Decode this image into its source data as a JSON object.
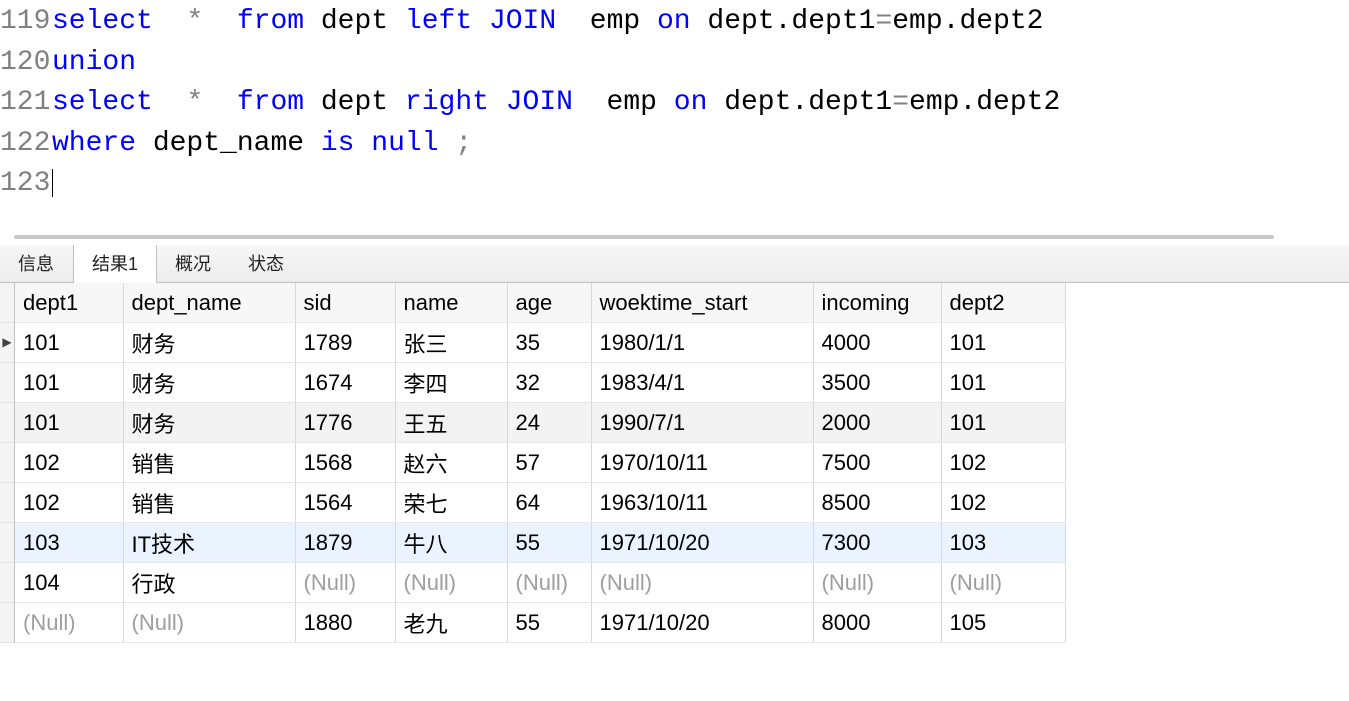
{
  "editor": {
    "lines": [
      {
        "num": 119,
        "tokens": [
          {
            "t": "select",
            "c": "kw"
          },
          {
            "t": "  "
          },
          {
            "t": "*",
            "c": "star"
          },
          {
            "t": "  "
          },
          {
            "t": "from",
            "c": "kw"
          },
          {
            "t": " dept "
          },
          {
            "t": "left",
            "c": "kw"
          },
          {
            "t": " "
          },
          {
            "t": "JOIN",
            "c": "kw"
          },
          {
            "t": "  emp "
          },
          {
            "t": "on",
            "c": "kw"
          },
          {
            "t": " dept.dept1"
          },
          {
            "t": "=",
            "c": "op"
          },
          {
            "t": "emp.dept2"
          }
        ]
      },
      {
        "num": 120,
        "tokens": [
          {
            "t": "union",
            "c": "kw"
          }
        ]
      },
      {
        "num": 121,
        "tokens": [
          {
            "t": "select",
            "c": "kw"
          },
          {
            "t": "  "
          },
          {
            "t": "*",
            "c": "star"
          },
          {
            "t": "  "
          },
          {
            "t": "from",
            "c": "kw"
          },
          {
            "t": " dept "
          },
          {
            "t": "right",
            "c": "kw"
          },
          {
            "t": " "
          },
          {
            "t": "JOIN",
            "c": "kw"
          },
          {
            "t": "  emp "
          },
          {
            "t": "on",
            "c": "kw"
          },
          {
            "t": " dept.dept1"
          },
          {
            "t": "=",
            "c": "op"
          },
          {
            "t": "emp.dept2"
          }
        ]
      },
      {
        "num": 122,
        "tokens": [
          {
            "t": "where",
            "c": "kw"
          },
          {
            "t": " dept_name "
          },
          {
            "t": "is",
            "c": "kw"
          },
          {
            "t": " "
          },
          {
            "t": "null",
            "c": "kw"
          },
          {
            "t": " "
          },
          {
            "t": ";",
            "c": "op"
          }
        ]
      },
      {
        "num": 123,
        "tokens": [],
        "cursor": true
      }
    ]
  },
  "tabs": [
    {
      "label": "信息",
      "active": false
    },
    {
      "label": "结果1",
      "active": true
    },
    {
      "label": "概况",
      "active": false
    },
    {
      "label": "状态",
      "active": false
    }
  ],
  "grid": {
    "null_label": "(Null)",
    "selected_row": 0,
    "columns": [
      {
        "key": "dept1",
        "label": "dept1",
        "numeric": false
      },
      {
        "key": "dept_name",
        "label": "dept_name",
        "numeric": false
      },
      {
        "key": "sid",
        "label": "sid",
        "numeric": false
      },
      {
        "key": "name",
        "label": "name",
        "numeric": false
      },
      {
        "key": "age",
        "label": "age",
        "numeric": true
      },
      {
        "key": "woektime_start",
        "label": "woektime_start",
        "numeric": false
      },
      {
        "key": "incoming",
        "label": "incoming",
        "numeric": true
      },
      {
        "key": "dept2",
        "label": "dept2",
        "numeric": false
      }
    ],
    "rows": [
      {
        "dept1": "101",
        "dept_name": "财务",
        "sid": "1789",
        "name": "张三",
        "age": 35,
        "woektime_start": "1980/1/1",
        "incoming": 4000,
        "dept2": "101"
      },
      {
        "dept1": "101",
        "dept_name": "财务",
        "sid": "1674",
        "name": "李四",
        "age": 32,
        "woektime_start": "1983/4/1",
        "incoming": 3500,
        "dept2": "101"
      },
      {
        "dept1": "101",
        "dept_name": "财务",
        "sid": "1776",
        "name": "王五",
        "age": 24,
        "woektime_start": "1990/7/1",
        "incoming": 2000,
        "dept2": "101"
      },
      {
        "dept1": "102",
        "dept_name": "销售",
        "sid": "1568",
        "name": "赵六",
        "age": 57,
        "woektime_start": "1970/10/11",
        "incoming": 7500,
        "dept2": "102"
      },
      {
        "dept1": "102",
        "dept_name": "销售",
        "sid": "1564",
        "name": "荣七",
        "age": 64,
        "woektime_start": "1963/10/11",
        "incoming": 8500,
        "dept2": "102"
      },
      {
        "dept1": "103",
        "dept_name": "IT技术",
        "sid": "1879",
        "name": "牛八",
        "age": 55,
        "woektime_start": "1971/10/20",
        "incoming": 7300,
        "dept2": "103"
      },
      {
        "dept1": "104",
        "dept_name": "行政",
        "sid": null,
        "name": null,
        "age": null,
        "woektime_start": null,
        "incoming": null,
        "dept2": null
      },
      {
        "dept1": null,
        "dept_name": null,
        "sid": "1880",
        "name": "老九",
        "age": 55,
        "woektime_start": "1971/10/20",
        "incoming": 8000,
        "dept2": "105"
      }
    ],
    "highlight_row": 5
  }
}
